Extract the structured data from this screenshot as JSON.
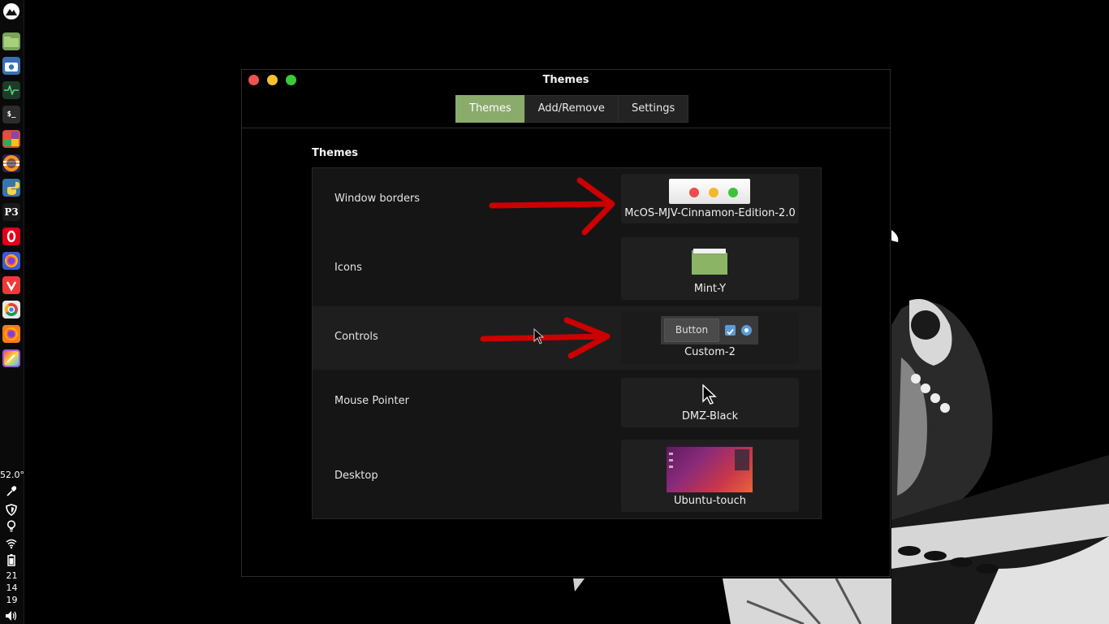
{
  "panel": {
    "launchers": [
      {
        "name": "menu-launcher",
        "icon": "mountain-logo-icon",
        "bg": "#f2f2f2"
      },
      {
        "name": "files-launcher",
        "icon": "folder-icon",
        "bg": "#7aa35a"
      },
      {
        "name": "screenshot-launcher",
        "icon": "camera-icon",
        "bg": "#3a6fb5"
      },
      {
        "name": "system-monitor-launcher",
        "icon": "activity-icon",
        "bg": "#1f3a2a"
      },
      {
        "name": "terminal-launcher",
        "icon": "terminal-icon",
        "bg": "#2c2c2c"
      },
      {
        "name": "color-launcher",
        "icon": "palette-icon",
        "bg": "#d14b3a"
      },
      {
        "name": "eclipse-launcher",
        "icon": "eclipse-icon",
        "bg": "#2c2255"
      },
      {
        "name": "python-launcher",
        "icon": "python-icon",
        "bg": "#3776ab"
      },
      {
        "name": "p3-launcher",
        "icon": "p3-icon",
        "bg": "#1a1a1a"
      },
      {
        "name": "opera-launcher",
        "icon": "opera-icon",
        "bg": "#e0001a"
      },
      {
        "name": "firefox-dev-launcher",
        "icon": "firefox-icon",
        "bg": "#3b5bdb"
      },
      {
        "name": "vivaldi-launcher",
        "icon": "vivaldi-icon",
        "bg": "#ef3939"
      },
      {
        "name": "chrome-launcher",
        "icon": "chrome-icon",
        "bg": "#e8e8e8"
      },
      {
        "name": "firefox-launcher",
        "icon": "firefox-icon",
        "bg": "#ff7a1a"
      },
      {
        "name": "themes-launcher",
        "icon": "paintbrush-icon",
        "bg": "#9c5ad8"
      }
    ],
    "temperature": "52.0°",
    "clock": {
      "hour": "21",
      "minute": "14",
      "second": "19"
    }
  },
  "window": {
    "title": "Themes",
    "controls": {
      "close": "#ef5350",
      "minimize": "#f5c02f",
      "maximize": "#3cc93c"
    },
    "tabs": [
      {
        "label": "Themes",
        "active": true
      },
      {
        "label": "Add/Remove",
        "active": false
      },
      {
        "label": "Settings",
        "active": false
      }
    ],
    "section_title": "Themes",
    "rows": [
      {
        "label": "Window borders",
        "value": "McOS-MJV-Cinnamon-Edition-2.0"
      },
      {
        "label": "Icons",
        "value": "Mint-Y"
      },
      {
        "label": "Controls",
        "value": "Custom-2",
        "preview_button": "Button"
      },
      {
        "label": "Mouse Pointer",
        "value": "DMZ-Black"
      },
      {
        "label": "Desktop",
        "value": "Ubuntu-touch"
      }
    ]
  },
  "colors": {
    "accent": "#8bab6c",
    "annotation_arrow": "#cc0000"
  }
}
